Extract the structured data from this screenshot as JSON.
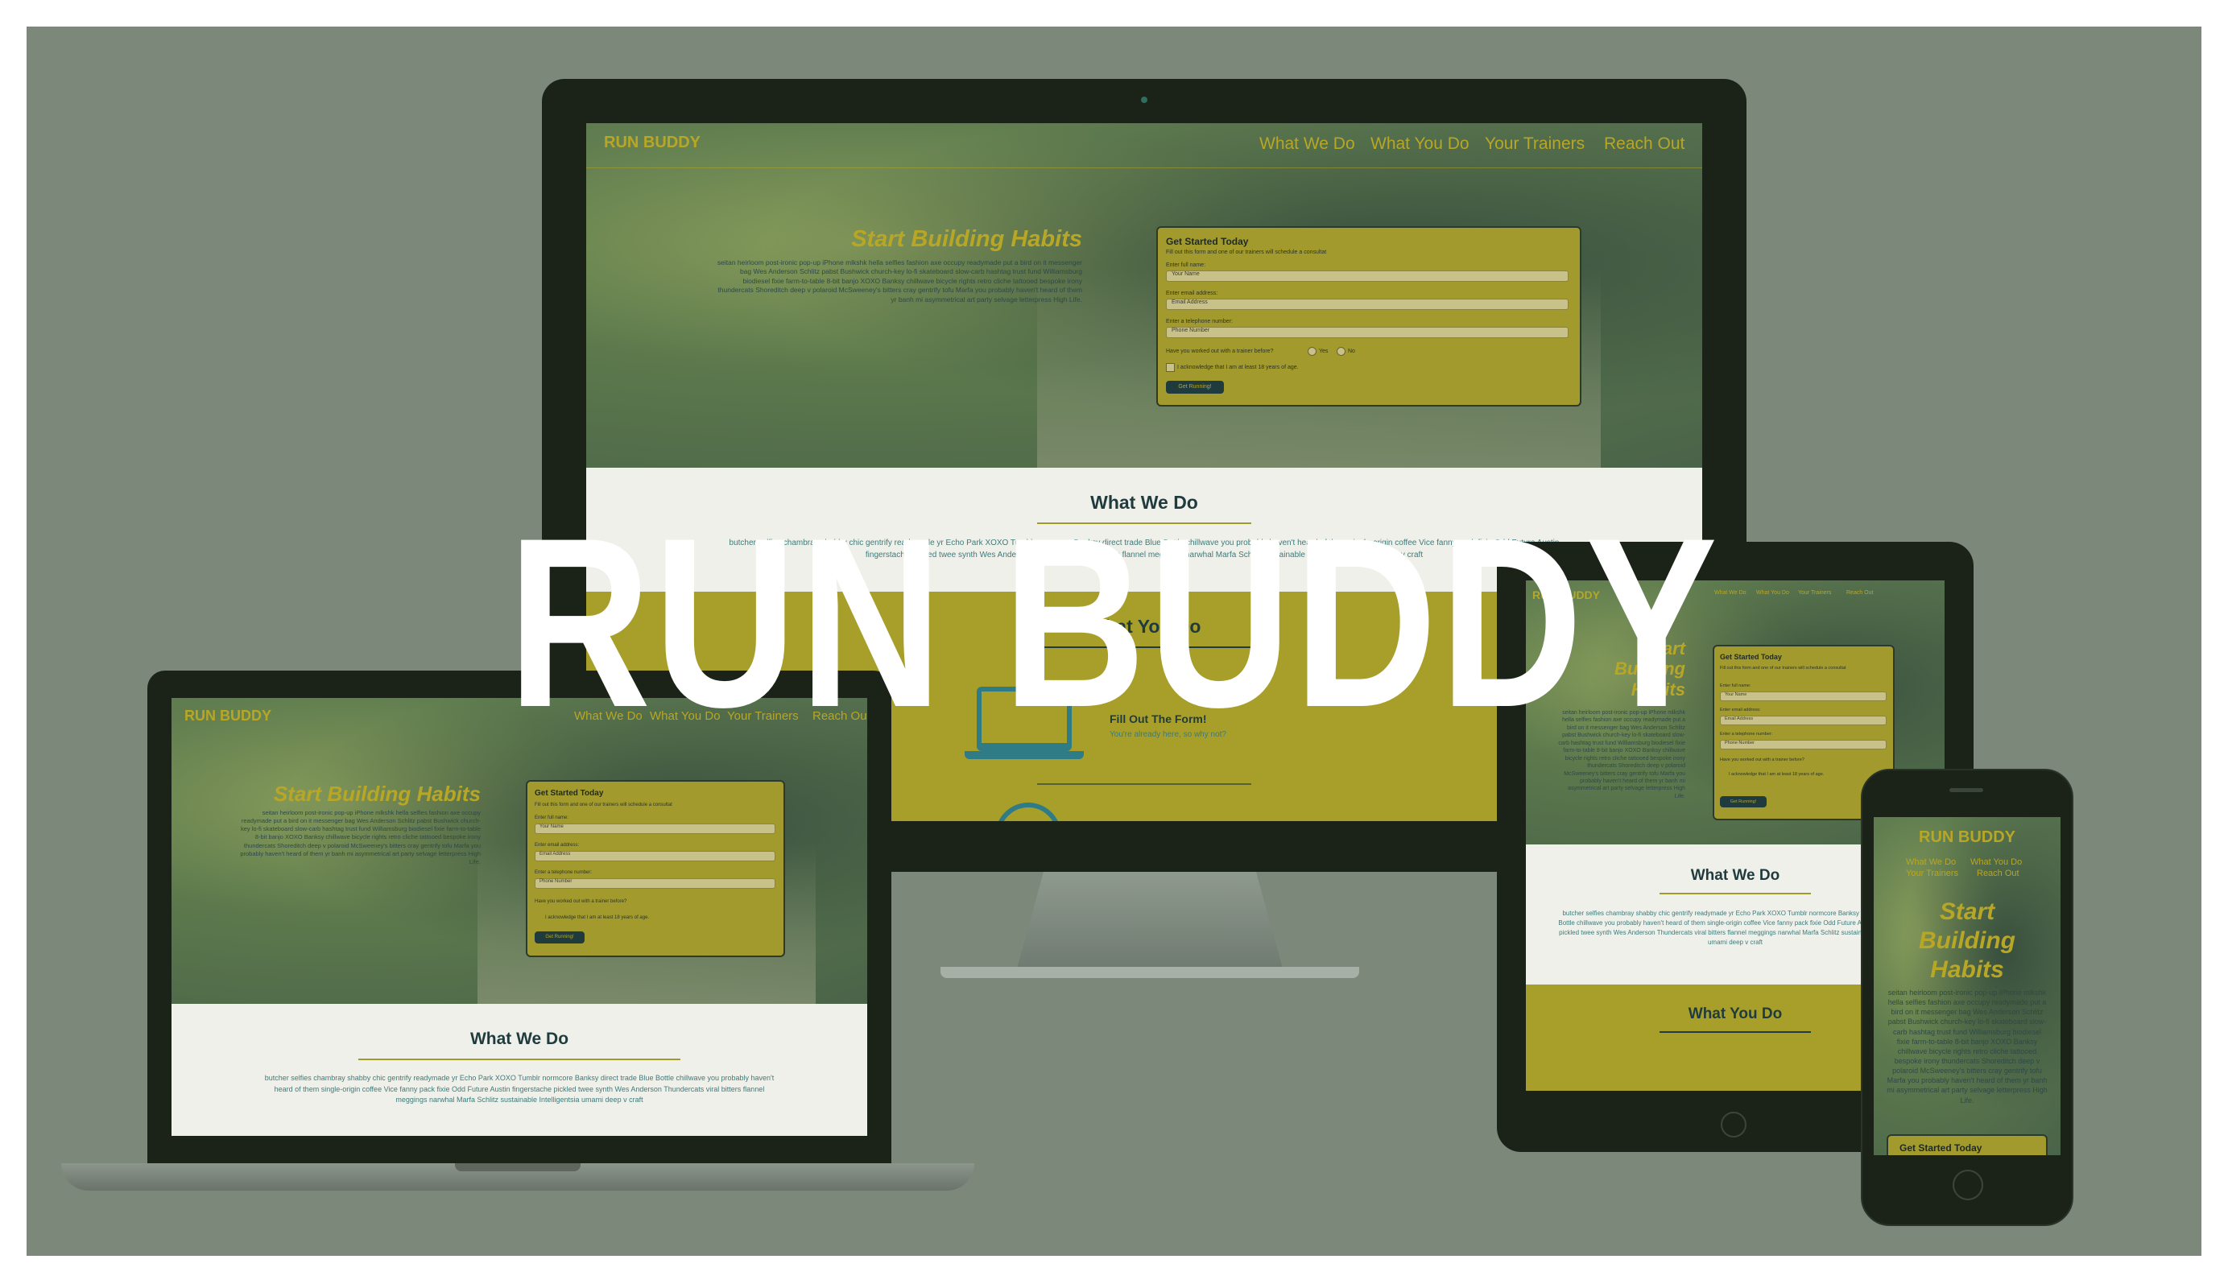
{
  "overlay": {
    "title": "RUN BUDDY"
  },
  "site": {
    "brand": "RUN BUDDY",
    "nav": [
      "What We Do",
      "What You Do",
      "Your Trainers",
      "Reach Out"
    ],
    "hero_title": "Start Building Habits",
    "hero_text": "seitan heirloom post-ironic pop-up iPhone mlkshk hella selfies fashion axe occupy readymade put a bird on it messenger bag Wes Anderson Schlitz pabst Bushwick church-key lo-fi skateboard slow-carb hashtag trust fund Williamsburg biodiesel fixie farm-to-table 8-bit banjo XOXO Banksy chillwave bicycle rights retro cliche tattooed bespoke irony thundercats Shoreditch deep v polaroid McSweeney's bitters cray gentrify tofu Marfa you probably haven't heard of them yr banh mi asymmetrical art party selvage letterpress High Life.",
    "form": {
      "title": "Get Started Today",
      "subtitle": "Fill out this form and one of our trainers will schedule a consultat",
      "name_label": "Enter full name:",
      "name_placeholder": "Your Name",
      "email_label": "Enter email address:",
      "email_placeholder": "Email Address",
      "phone_label": "Enter a telephone number:",
      "phone_placeholder": "Phone Number",
      "question": "Have you worked out with a trainer before?",
      "yes": "Yes",
      "no": "No",
      "ack": "I acknowledge that I am at least 18 years of age.",
      "button": "Get Running!"
    },
    "what_we_do": {
      "title": "What We Do",
      "text": "butcher selfies chambray shabby chic gentrify readymade yr Echo Park XOXO Tumblr normcore Banksy direct trade Blue Bottle chillwave you probably haven't heard of them single-origin coffee Vice fanny pack fixie Odd Future Austin fingerstache pickled twee synth Wes Anderson Thundercats viral bitters flannel meggings narwhal Marfa Schlitz sustainable Intelligentsia umami deep v craft"
    },
    "what_you_do": {
      "title": "What You Do",
      "step_title": "Fill Out The Form!",
      "step_text": "You're already here, so why not?"
    }
  },
  "colors": {
    "gold": "#b8a627",
    "teal": "#1f3b3e",
    "overlay_bg": "#7c887a"
  }
}
